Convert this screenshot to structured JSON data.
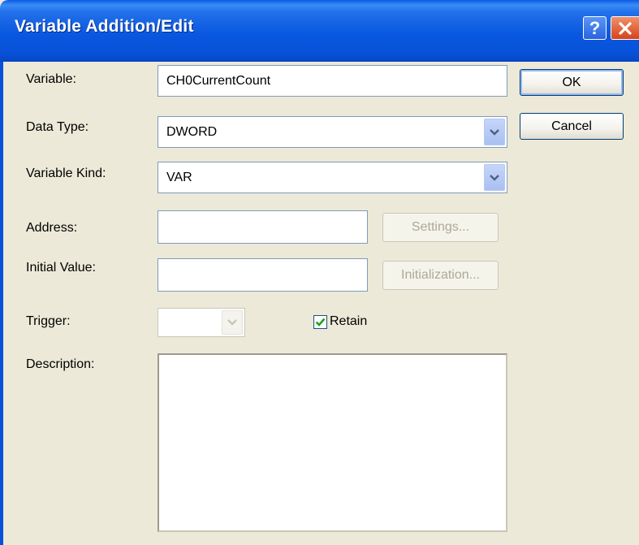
{
  "window": {
    "title": "Variable Addition/Edit",
    "help_glyph": "?",
    "close_icon": "close-icon"
  },
  "colors": {
    "titlebar": "#0a58e0",
    "dialog_bg": "#ece9d8",
    "field_border": "#7f9db9",
    "check_mark": "#21a121"
  },
  "form": {
    "variable": {
      "label": "Variable:",
      "value": "CH0CurrentCount"
    },
    "data_type": {
      "label": "Data Type:",
      "value": "DWORD"
    },
    "variable_kind": {
      "label": "Variable Kind:",
      "value": "VAR"
    },
    "address": {
      "label": "Address:",
      "value": "",
      "settings_label": "Settings..."
    },
    "initial_value": {
      "label": "Initial Value:",
      "value": "",
      "initialization_label": "Initialization..."
    },
    "trigger": {
      "label": "Trigger:",
      "value": ""
    },
    "retain": {
      "label": "Retain",
      "checked": true
    },
    "description": {
      "label": "Description:",
      "value": ""
    }
  },
  "buttons": {
    "ok": "OK",
    "cancel": "Cancel"
  }
}
